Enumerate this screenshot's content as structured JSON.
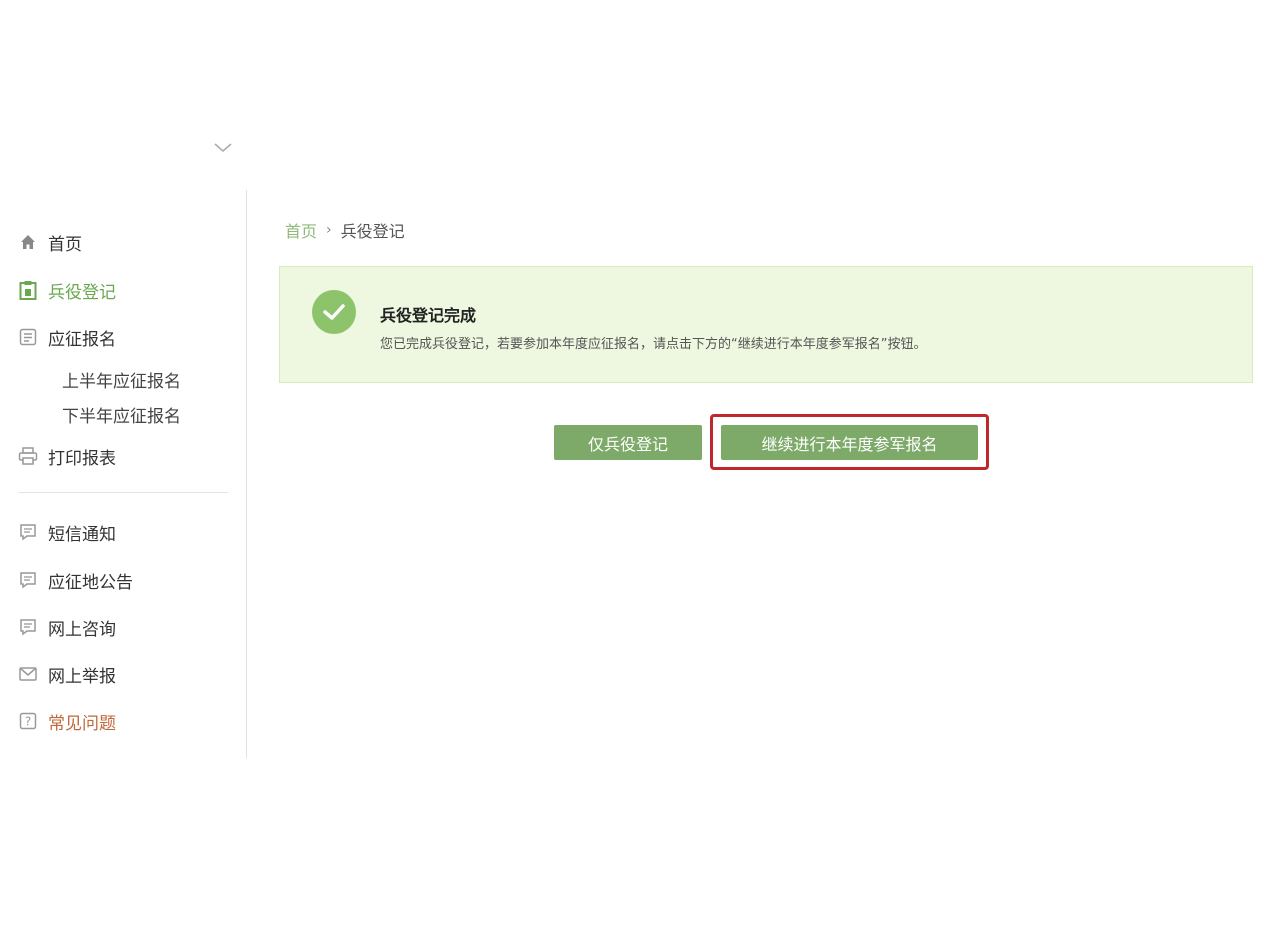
{
  "colors": {
    "accent": "#7daa69",
    "active_nav": "#6aa84f",
    "help_nav": "#c0683a",
    "notice_bg": "#eef7df",
    "highlight_border": "#c0262b"
  },
  "sidebar": {
    "items": [
      {
        "label": "首页",
        "icon": "home-icon"
      },
      {
        "label": "兵役登记",
        "icon": "clipboard-icon"
      },
      {
        "label": "应征报名",
        "icon": "document-icon"
      },
      {
        "label": "打印报表",
        "icon": "printer-icon"
      },
      {
        "label": "短信通知",
        "icon": "chat-icon"
      },
      {
        "label": "应征地公告",
        "icon": "chat-icon"
      },
      {
        "label": "网上咨询",
        "icon": "chat-icon"
      },
      {
        "label": "网上举报",
        "icon": "mail-icon"
      },
      {
        "label": "常见问题",
        "icon": "question-icon"
      }
    ],
    "sub_items": [
      "上半年应征报名",
      "下半年应征报名"
    ]
  },
  "breadcrumb": {
    "home": "首页",
    "separator": "›",
    "current": "兵役登记"
  },
  "notice": {
    "title": "兵役登记完成",
    "text": "您已完成兵役登记，若要参加本年度应征报名，请点击下方的“继续进行本年度参军报名”按钮。"
  },
  "buttons": {
    "only_register": "仅兵役登记",
    "continue_enlist": "继续进行本年度参军报名"
  }
}
